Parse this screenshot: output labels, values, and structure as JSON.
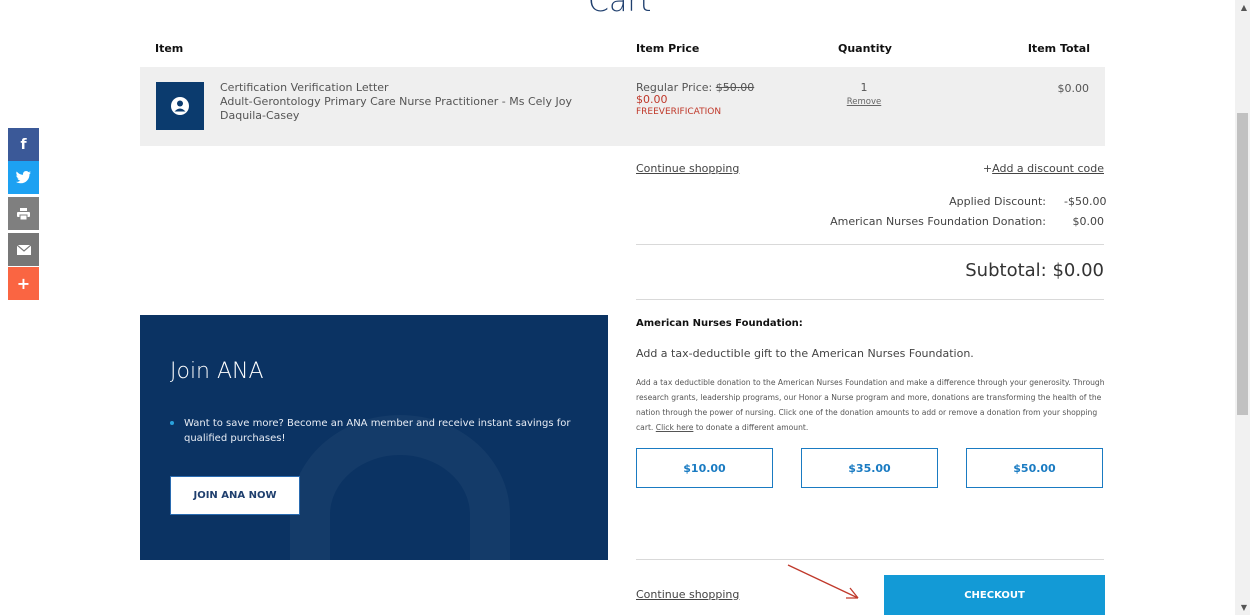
{
  "page": {
    "title": "Cart"
  },
  "cart": {
    "headers": {
      "item": "Item",
      "price": "Item Price",
      "qty": "Quantity",
      "total": "Item Total"
    },
    "item": {
      "icon": "user-badge-icon",
      "name": "Certification Verification Letter",
      "detail": "Adult-Gerontology Primary Care Nurse Practitioner - Ms Cely Joy Daquila-Casey",
      "regular_label": "Regular Price:",
      "regular_price": "$50.00",
      "sale_price": "$0.00",
      "promo_code": "FREEVERIFICATION",
      "quantity": "1",
      "remove": "Remove",
      "total": "$0.00"
    }
  },
  "summary": {
    "continue_shopping": "Continue shopping",
    "discount_plus": "+",
    "add_discount": "Add a discount code",
    "applied_discount_label": "Applied Discount:",
    "applied_discount_value": "-$50.00",
    "donation_label": "American Nurses Foundation Donation:",
    "donation_value": "$0.00",
    "subtotal": "Subtotal: $0.00"
  },
  "foundation": {
    "title": "American Nurses Foundation:",
    "subtitle": "Add a tax-deductible gift to the American Nurses Foundation.",
    "body": "Add a tax deductible donation to the American Nurses Foundation and make a difference through your generosity. Through research grants, leadership programs, our Honor a Nurse program and more, donations are transforming the health of the nation through the power of nursing. Click one of the donation amounts to add or remove a donation from your shopping cart.",
    "click_here": "Click here",
    "body_tail": "to donate a different amount.",
    "amounts": [
      "$10.00",
      "$35.00",
      "$50.00"
    ]
  },
  "join": {
    "title": "Join ANA",
    "text": "Want to save more? Become an ANA member and receive instant savings for qualified purchases!",
    "button": "JOIN ANA NOW"
  },
  "footer": {
    "continue_shopping": "Continue shopping",
    "checkout": "CHECKOUT"
  },
  "social": {
    "facebook": "f",
    "print_icon": "printer-icon",
    "email_icon": "envelope-icon",
    "plus": "+"
  },
  "colors": {
    "navy": "#0b3363",
    "accent": "#139ad6",
    "sale": "#c0392b"
  }
}
